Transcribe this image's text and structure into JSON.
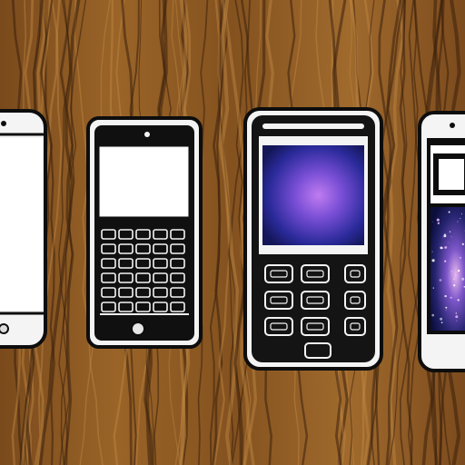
{
  "scene": {
    "background": "wood-grain",
    "colors": {
      "wood_base": "#8b5a26",
      "wood_light": "#c08a45",
      "wood_dark": "#3b200c",
      "phone_outline": "#0d0d0d",
      "phone_white": "#f4f4f4",
      "screen_white": "#ffffff",
      "nebula_center": "#b06ce8",
      "nebula_edge": "#1a1d7a",
      "galaxy_dark": "#0b0d3a",
      "keypad_bezel": "#171717"
    },
    "phones": [
      {
        "name": "smartphone-left-cropped",
        "style": "blank white touchscreen"
      },
      {
        "name": "qwerty-keyboard-phone",
        "style": "white screen with full qwerty keypad"
      },
      {
        "name": "keypad-phone",
        "style": "purple nebula screen with numeric keypad"
      },
      {
        "name": "smartphone-right-cropped",
        "style": "galaxy screen with white header"
      }
    ]
  }
}
